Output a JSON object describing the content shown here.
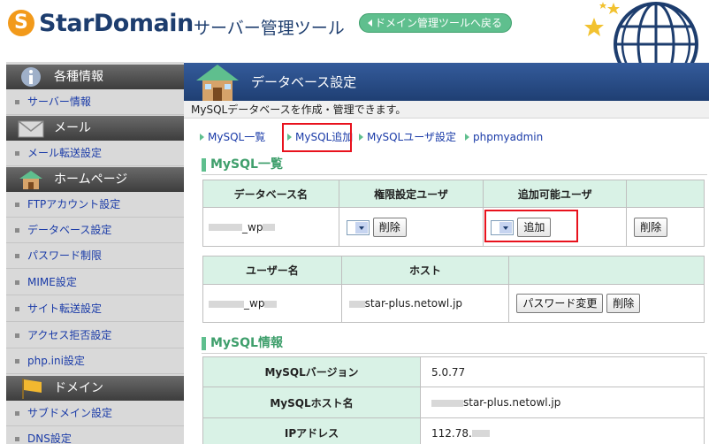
{
  "header": {
    "logo_mark": "S",
    "logo_text": "StarDomain",
    "subtitle": "サーバー管理ツール",
    "back_button": "ドメイン管理ツールへ戻る"
  },
  "sidebar": {
    "sections": [
      {
        "title": "各種情報",
        "icon": "info-icon",
        "items": [
          "サーバー情報"
        ]
      },
      {
        "title": "メール",
        "icon": "mail-icon",
        "items": [
          "メール転送設定"
        ]
      },
      {
        "title": "ホームページ",
        "icon": "house-icon",
        "items": [
          "FTPアカウント設定",
          "データベース設定",
          "パスワード制限",
          "MIME設定",
          "サイト転送設定",
          "アクセス拒否設定",
          "php.ini設定"
        ]
      },
      {
        "title": "ドメイン",
        "icon": "flag-icon",
        "items": [
          "サブドメイン設定",
          "DNS設定"
        ]
      }
    ]
  },
  "page": {
    "title": "データベース設定",
    "description": "MySQLデータベースを作成・管理できます。"
  },
  "tabs": [
    "MySQL一覧",
    "MySQL追加",
    "MySQLユーザ設定",
    "phpmyadmin"
  ],
  "list_section": {
    "title": "MySQL一覧",
    "db_table": {
      "headers": [
        "データベース名",
        "権限設定ユーザ",
        "追加可能ユーザ"
      ],
      "row": {
        "db_name": "_wp",
        "delete_label": "削除",
        "add_label": "追加",
        "delete2_label": "削除"
      }
    },
    "user_table": {
      "headers": [
        "ユーザー名",
        "ホスト"
      ],
      "row": {
        "user": "_wp",
        "host": "star-plus.netowl.jp",
        "password_label": "パスワード変更",
        "delete_label": "削除"
      }
    }
  },
  "info_section": {
    "title": "MySQL情報",
    "rows": [
      {
        "label": "MySQLバージョン",
        "value": "5.0.77"
      },
      {
        "label": "MySQLホスト名",
        "value": "star-plus.netowl.jp"
      },
      {
        "label": "IPアドレス",
        "value": "112.78."
      }
    ]
  },
  "colors": {
    "accent_green": "#5fbf8e",
    "brand_navy": "#1d3d6e",
    "logo_orange": "#f29a1b",
    "highlight_red": "#e8121d"
  }
}
